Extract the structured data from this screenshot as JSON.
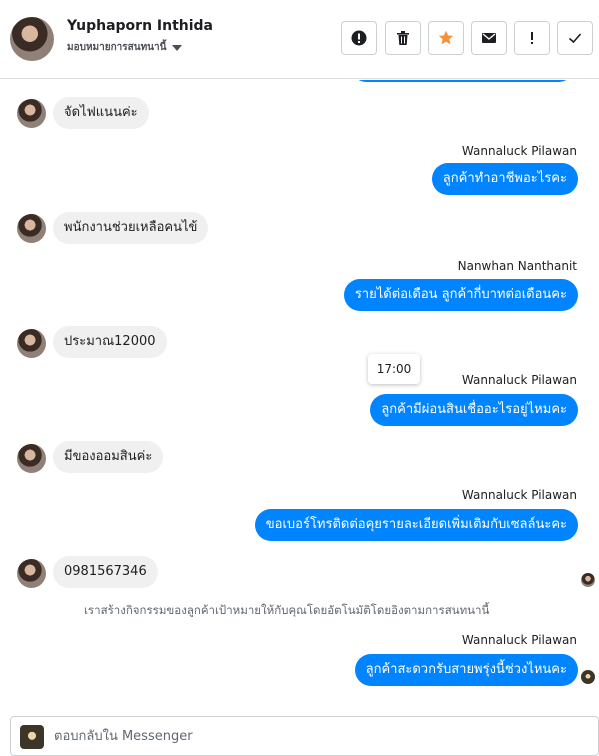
{
  "header": {
    "name": "Yuphaporn Inthida",
    "subtitle": "มอบหมายการสนทนานี้",
    "actions": [
      {
        "id": "spam",
        "icon": "alert-circle-icon"
      },
      {
        "id": "delete",
        "icon": "trash-icon"
      },
      {
        "id": "star",
        "icon": "star-icon",
        "color": "#f7923b"
      },
      {
        "id": "unread",
        "icon": "envelope-icon"
      },
      {
        "id": "follow-up",
        "icon": "exclamation-icon"
      },
      {
        "id": "done",
        "icon": "check-icon"
      }
    ]
  },
  "messages": [
    {
      "direction": "in",
      "text": "จัดไฟแนนค่ะ"
    },
    {
      "direction": "out",
      "sender": "Wannaluck Pilawan",
      "text": "ลูกค้าทำอาชีพอะไรคะ"
    },
    {
      "direction": "in",
      "text": "พนักงานช่วยเหลือคนไข้"
    },
    {
      "direction": "out",
      "sender": "Nanwhan Nanthanit",
      "text": "รายได้ต่อเดือน ลูกค้ากี่บาทต่อเดือนคะ"
    },
    {
      "direction": "in",
      "text": "ประมาณ12000"
    },
    {
      "direction": "out",
      "sender": "Wannaluck Pilawan",
      "text": "ลูกค้ามีผ่อนสินเชื่ออะไรอยู่ไหมคะ",
      "tooltip": "17:00"
    },
    {
      "direction": "in",
      "text": "มีของออมสินค่ะ"
    },
    {
      "direction": "out",
      "sender": "Wannaluck Pilawan",
      "text": "ขอเบอร์โทรติดต่อคุยรายละเอียดเพิ่มเติมกับเซลล์นะคะ"
    },
    {
      "direction": "in",
      "text": "0981567346"
    },
    {
      "direction": "system",
      "text": "เราสร้างกิจกรรมของลูกค้าเป้าหมายให้กับคุณโดยอัตโนมัติโดยอิงตามการสนทนานี้"
    },
    {
      "direction": "out",
      "sender": "Wannaluck Pilawan",
      "text": "ลูกค้าสะดวกรับสายพรุ่งนี้ช่วงไหนคะ"
    }
  ],
  "composer": {
    "placeholder": "ตอบกลับใน Messenger"
  },
  "colors": {
    "outgoing_bubble": "#0084ff",
    "incoming_bubble": "#f1f0f0",
    "star": "#f7923b"
  }
}
